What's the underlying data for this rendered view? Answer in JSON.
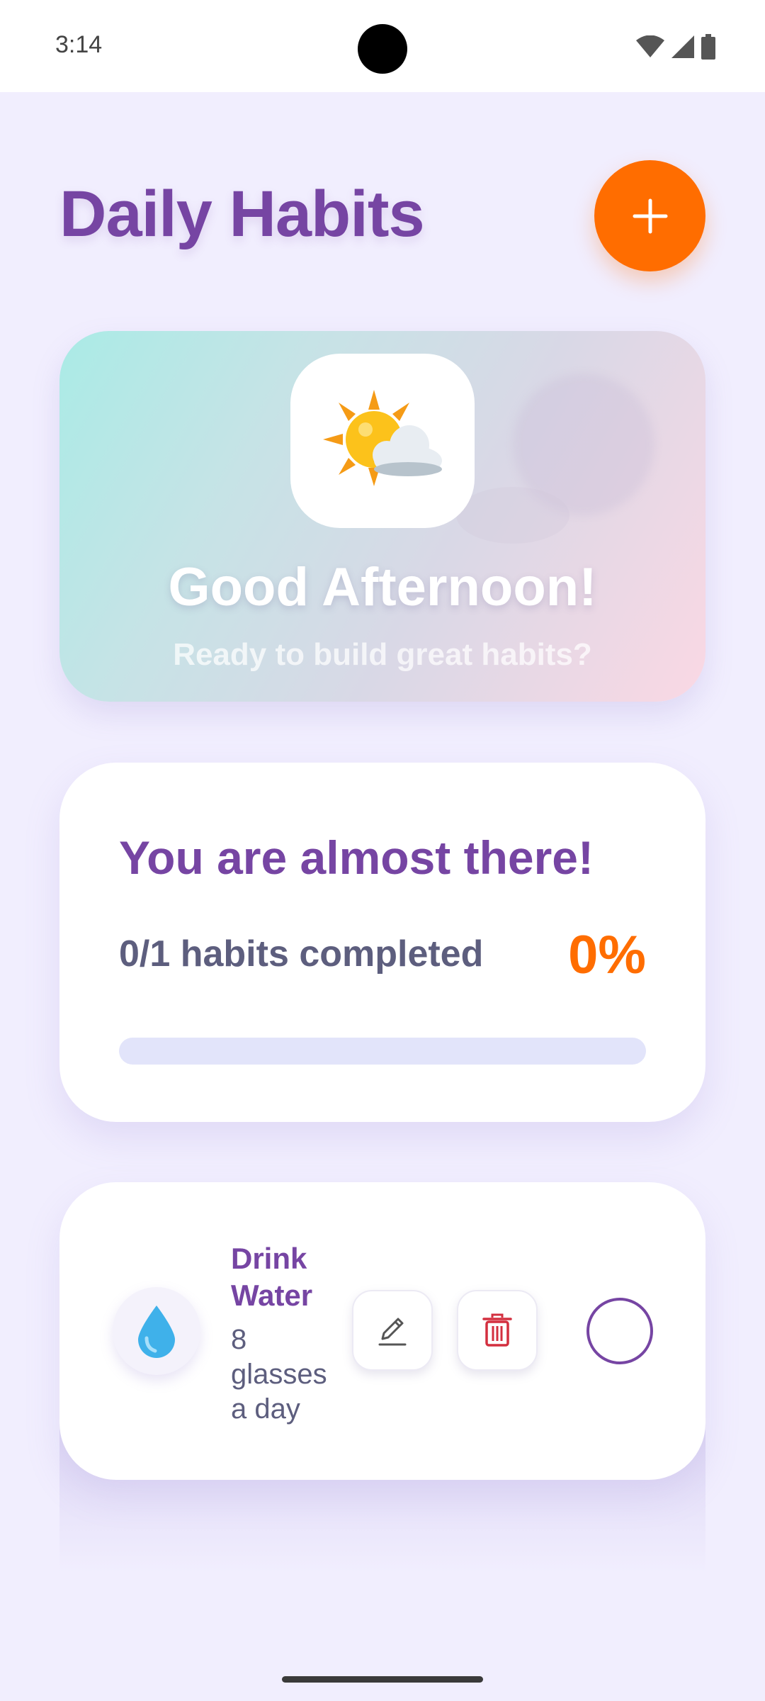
{
  "status_bar": {
    "time": "3:14",
    "icons": [
      "wifi-icon",
      "signal-icon",
      "battery-icon"
    ]
  },
  "header": {
    "title": "Daily Habits",
    "add_icon": "plus-icon",
    "add_color": "#ff6d00"
  },
  "greeting": {
    "icon": "sun-behind-cloud-icon",
    "title": "Good Afternoon!",
    "subtitle": "Ready to build great habits?"
  },
  "progress": {
    "heading": "You are almost there!",
    "summary": "0/1 habits completed",
    "percent_label": "0%",
    "completed": 0,
    "total": 1,
    "fraction": 0
  },
  "habits": [
    {
      "icon": "water-drop-icon",
      "name": "Drink Water",
      "description": "8 glasses a day",
      "edit_icon": "pencil-icon",
      "delete_icon": "trash-icon",
      "completed": false
    }
  ],
  "colors": {
    "primary": "#7645a3",
    "accent": "#ff6d00",
    "text_secondary": "#5d5e7e",
    "danger": "#d32f3f",
    "background": "#f1eefe"
  }
}
